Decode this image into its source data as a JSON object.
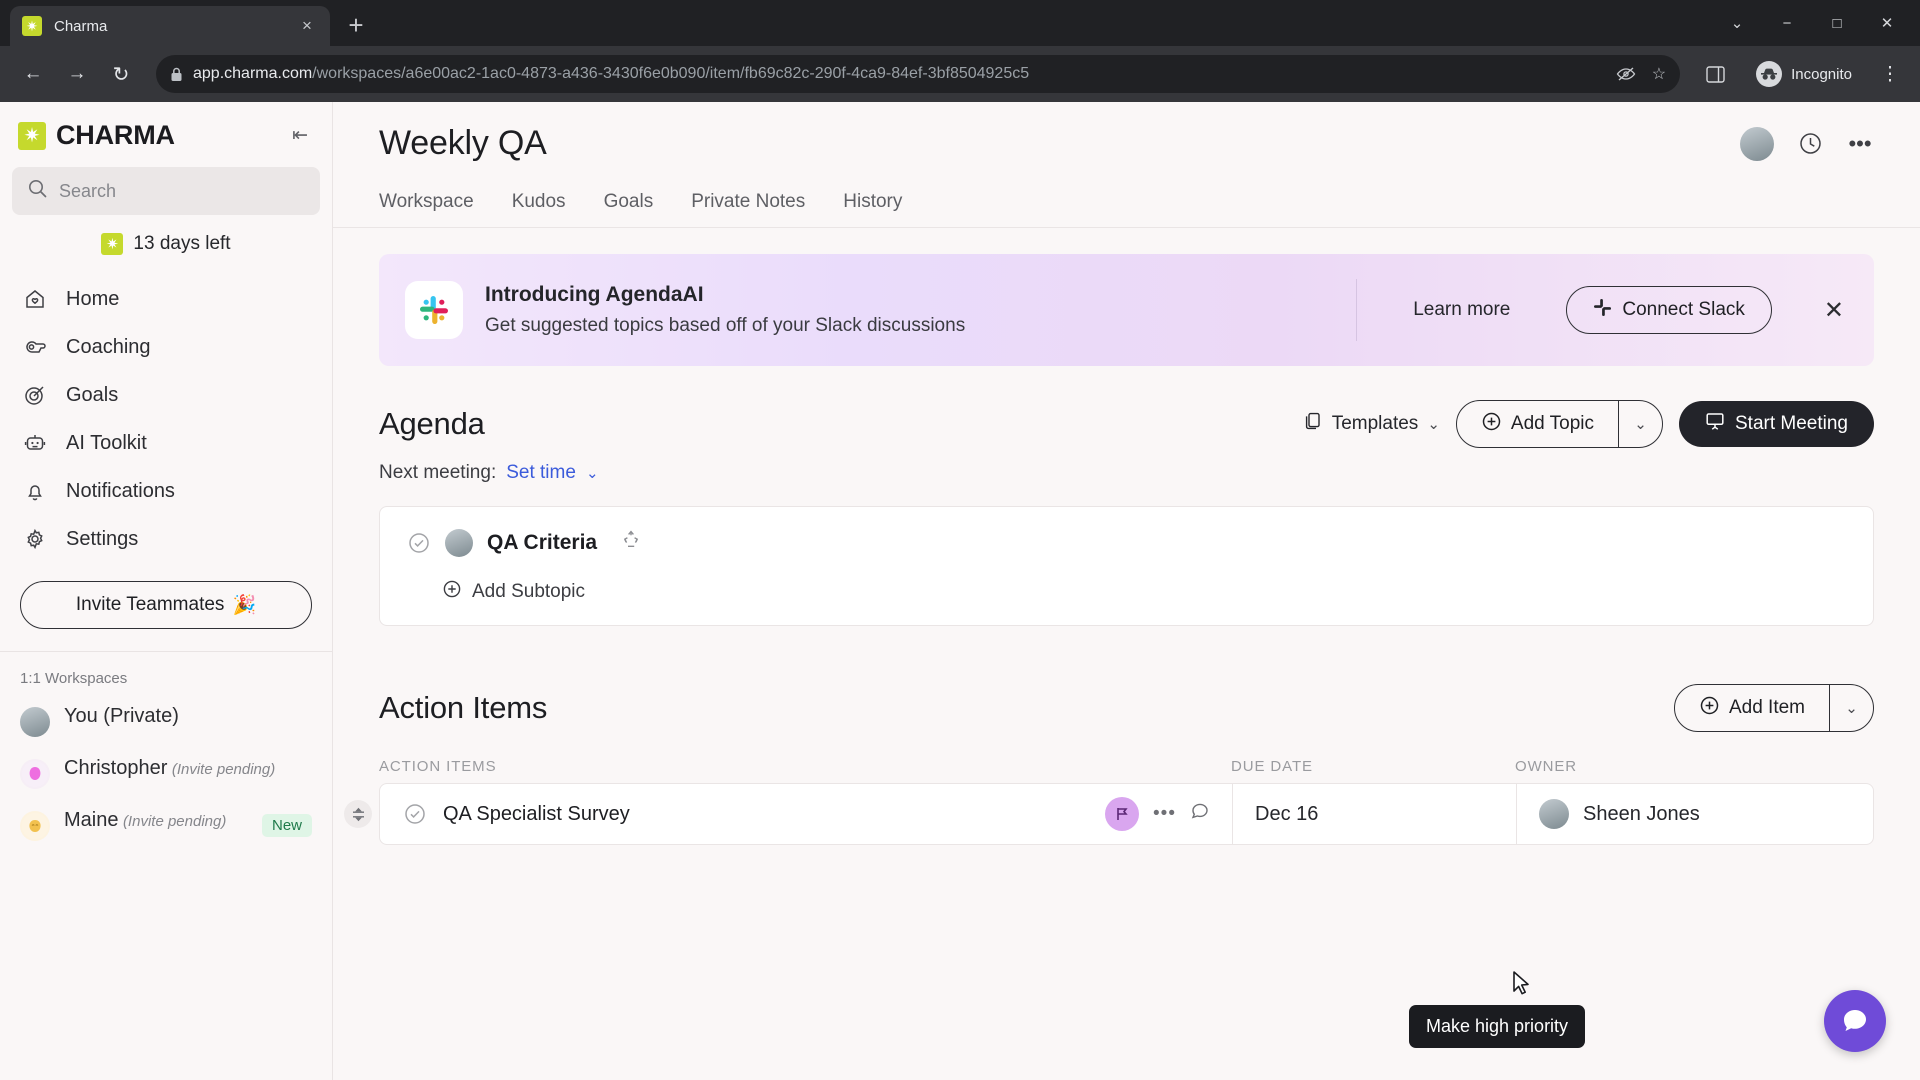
{
  "browser": {
    "tab": {
      "title": "Charma",
      "favicon": "charma-star-icon",
      "close_label": "×"
    },
    "new_tab_label": "+",
    "window_controls": {
      "minimize": "−",
      "maximize": "□",
      "close": "✕",
      "chevron": "⌄"
    },
    "nav": {
      "back": "←",
      "forward": "→",
      "reload": "↻"
    },
    "url": {
      "host": "app.charma.com",
      "path": "/workspaces/a6e00ac2-1ac0-4873-a436-3430f6e0b090/item/fb69c82c-290f-4ca9-84ef-3bf8504925c5",
      "lock": "🔒"
    },
    "omnibox_icons": {
      "tracking": "eye-off-icon",
      "bookmark": "☆",
      "sidepanel": "◧"
    },
    "profile": {
      "label": "Incognito"
    },
    "menu": "⋮"
  },
  "sidebar": {
    "brand": "CHARMA",
    "collapse_label": "⇤",
    "search": {
      "placeholder": "Search",
      "value": ""
    },
    "trial": "13 days left",
    "nav_items": [
      {
        "label": "Home",
        "icon": "home-icon"
      },
      {
        "label": "Coaching",
        "icon": "whistle-icon"
      },
      {
        "label": "Goals",
        "icon": "target-icon"
      },
      {
        "label": "AI Toolkit",
        "icon": "robot-icon"
      },
      {
        "label": "Notifications",
        "icon": "bell-icon"
      },
      {
        "label": "Settings",
        "icon": "gear-icon"
      }
    ],
    "invite_button": "Invite Teammates",
    "invite_emoji": "🎉",
    "workspaces_heading": "1:1 Workspaces",
    "workspaces": [
      {
        "name": "You (Private)",
        "status": "",
        "badge": ""
      },
      {
        "name": "Christopher",
        "status": "(Invite pending)",
        "badge": ""
      },
      {
        "name": "Maine",
        "status": "(Invite pending)",
        "badge": "New"
      }
    ]
  },
  "header": {
    "title": "Weekly QA",
    "avatar": "user-avatar",
    "history_icon": "clock-icon",
    "more_icon": "•••"
  },
  "tabs": [
    {
      "label": "Workspace"
    },
    {
      "label": "Kudos"
    },
    {
      "label": "Goals"
    },
    {
      "label": "Private Notes"
    },
    {
      "label": "History"
    }
  ],
  "banner": {
    "icon": "slack-icon",
    "title": "Introducing AgendaAI",
    "subtitle": "Get suggested topics based off of your Slack discussions",
    "learn_more": "Learn more",
    "connect_button": "Connect Slack",
    "close": "✕",
    "accent": "#ead9f8"
  },
  "agenda": {
    "title": "Agenda",
    "templates_label": "Templates",
    "templates_caret": "⌄",
    "add_topic_label": "Add Topic",
    "add_topic_caret": "⌄",
    "start_meeting_label": "Start Meeting",
    "next_meeting_label": "Next meeting:",
    "set_time_label": "Set time",
    "set_time_caret": "⌄",
    "topics": [
      {
        "name": "QA Criteria",
        "recycle_icon": "recurring-icon",
        "add_subtopic_label": "Add Subtopic"
      }
    ]
  },
  "action_items": {
    "title": "Action Items",
    "add_item_label": "Add Item",
    "add_item_caret": "⌄",
    "columns": [
      "ACTION ITEMS",
      "DUE DATE",
      "OWNER"
    ],
    "rows": [
      {
        "title": "QA Specialist Survey",
        "due_date": "Dec 16",
        "owner": "Sheen Jones",
        "priority_icon": "priority-flag-icon",
        "more_icon": "•••",
        "comment_icon": "comment-icon"
      }
    ]
  },
  "tooltip": {
    "text": "Make high priority"
  },
  "intercom": {
    "label": "messenger-icon"
  },
  "colors": {
    "brand_green": "#c5d92d",
    "priority_purple": "#d9a6ef",
    "link_blue": "#3b5bdb",
    "dark_button": "#23242a",
    "new_badge_green": "#1f7a4a"
  }
}
